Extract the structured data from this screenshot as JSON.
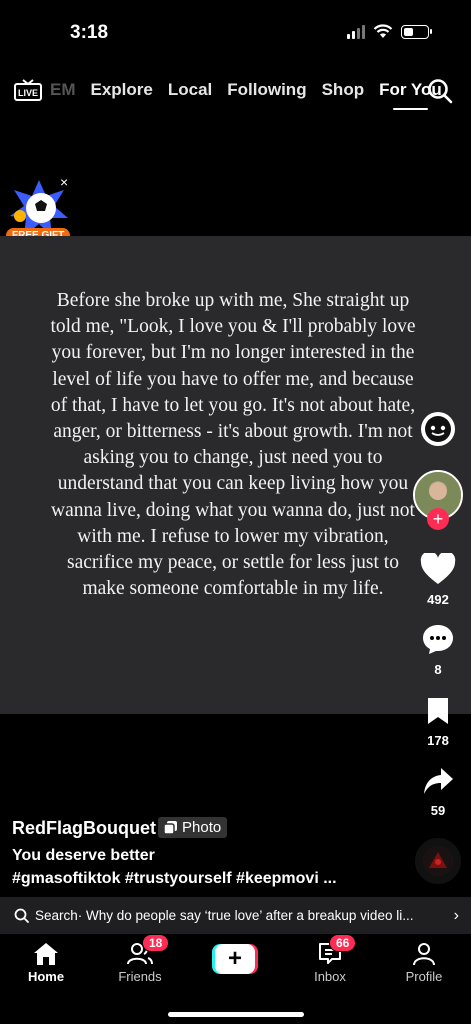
{
  "status": {
    "time": "3:18"
  },
  "topnav": {
    "live_label": "LIVE",
    "tabs": [
      "EM",
      "Explore",
      "Local",
      "Following",
      "Shop",
      "For You"
    ],
    "active_tab": "For You"
  },
  "gift": {
    "label": "FREE GIFT",
    "close": "×"
  },
  "post": {
    "quote": "Before she broke up with me, She straight up told me, \"Look, I love you & I'll probably love you forever, but I'm no longer interested in the level of life you have to offer me, and because of that, I have to let you go. It's not about hate, anger, or bitterness - it's about growth. I'm not asking you to change, just need you to understand that you can keep living how you wanna live, doing what you wanna do, just not with me. I refuse to lower my vibration, sacrifice my peace, or settle for less just to make someone comfortable in my life.",
    "username": "RedFlagBouquet",
    "type_badge": "Photo",
    "caption": "You deserve better",
    "hashtags": "#gmasoftiktok #trustyourself #keepmovi ..."
  },
  "rail": {
    "likes": "492",
    "comments": "8",
    "saves": "178",
    "shares": "59",
    "follow": "+"
  },
  "search_suggestion": {
    "prefix": "Search",
    "text": " · Why do people say ‘true love’ after a breakup video li..."
  },
  "tabbar": {
    "home": "Home",
    "friends": "Friends",
    "friends_badge": "18",
    "create": "+",
    "inbox": "Inbox",
    "inbox_badge": "66",
    "profile": "Profile"
  },
  "colors": {
    "accent": "#fe2c55",
    "cyan": "#25f4ee",
    "card": "#2a2a2c"
  }
}
